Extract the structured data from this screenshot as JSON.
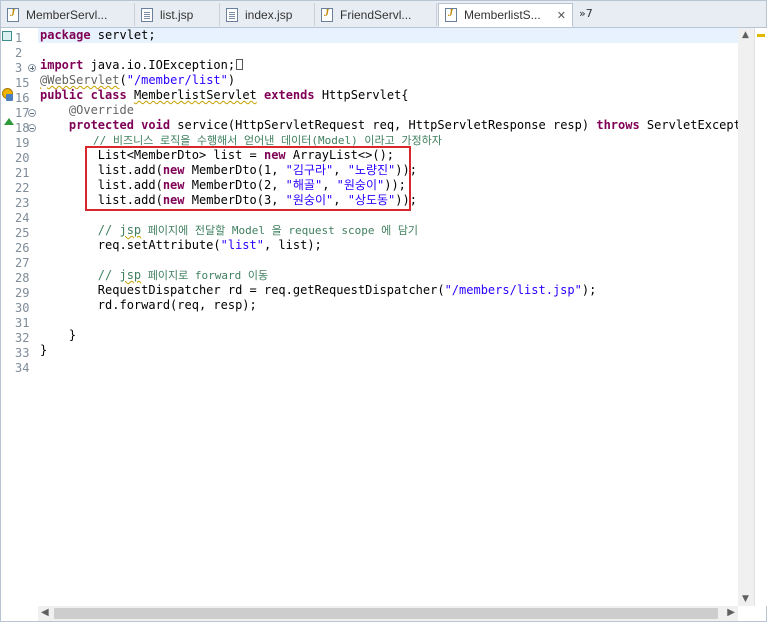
{
  "tabs": [
    {
      "label": "MemberServl...",
      "type": "java",
      "active": false
    },
    {
      "label": "list.jsp",
      "type": "jsp",
      "active": false
    },
    {
      "label": "index.jsp",
      "type": "jsp",
      "active": false
    },
    {
      "label": "FriendServl...",
      "type": "java",
      "active": false
    },
    {
      "label": "MemberlistS...",
      "type": "java",
      "active": true
    }
  ],
  "tab_overflow_label": "»7",
  "tab_close_glyph": "✕",
  "line_numbers": [
    "1",
    "2",
    "3",
    "15",
    "16",
    "17",
    "18",
    "19",
    "20",
    "21",
    "22",
    "23",
    "24",
    "25",
    "26",
    "27",
    "28",
    "29",
    "30",
    "31",
    "32",
    "33",
    "34"
  ],
  "code": {
    "l1_kw": "package",
    "l1_rest": " servlet;",
    "l3_kw": "import",
    "l3_rest": " java.io.IOException;",
    "l15_ann": "@WebServlet",
    "l15_p1": "(",
    "l15_str": "\"/member/list\"",
    "l15_p2": ")",
    "l16_kw1": "public",
    "l16_kw2": "class",
    "l16_cls": "MemberlistServlet",
    "l16_kw3": "extends",
    "l16_rest": " HttpServlet{",
    "l17_ann": "    @Override",
    "l18_kw1": "protected",
    "l18_kw2": "void",
    "l18_mid": " service(HttpServletRequest req, HttpServletResponse resp) ",
    "l18_kw3": "throws",
    "l18_rest": " ServletExceptio",
    "l19_cmt": "// 비즈니스 로직을 수행해서 얻어낸 데이터(Model) 이라고 가정하자",
    "l20_a": "List<MemberDto> list = ",
    "l20_kw": "new",
    "l20_b": " ArrayList<>();",
    "l21_a": "list.add(",
    "l21_kw": "new",
    "l21_b": " MemberDto(1, ",
    "l21_s1": "\"김구라\"",
    "l21_c": ", ",
    "l21_s2": "\"노량진\"",
    "l21_d": "));",
    "l22_a": "list.add(",
    "l22_kw": "new",
    "l22_b": " MemberDto(2, ",
    "l22_s1": "\"해골\"",
    "l22_c": ", ",
    "l22_s2": "\"원숭이\"",
    "l22_d": "));",
    "l23_a": "list.add(",
    "l23_kw": "new",
    "l23_b": " MemberDto(3, ",
    "l23_s1": "\"원숭이\"",
    "l23_c": ", ",
    "l23_s2": "\"상도동\"",
    "l23_d": "));",
    "l25_cmt_a": "// ",
    "l25_cmt_sq": "jsp",
    "l25_cmt_b": " 페이지에 전달할 Model 을 request scope 에 담기",
    "l26_a": "req.setAttribute(",
    "l26_str": "\"list\"",
    "l26_b": ", list);",
    "l28_cmt_a": "// ",
    "l28_cmt_sq": "jsp",
    "l28_cmt_b": " 페이지로 forward 이동",
    "l29_a": "RequestDispatcher rd = req.getRequestDispatcher(",
    "l29_str": "\"/members/list.jsp\"",
    "l29_b": ");",
    "l30": "rd.forward(req, resp);",
    "l32": "    }",
    "l33": "}"
  },
  "colors": {
    "keyword": "#7f0055",
    "string": "#2a00ff",
    "comment": "#3f7f5f",
    "highlight_box": "#d9262c"
  }
}
